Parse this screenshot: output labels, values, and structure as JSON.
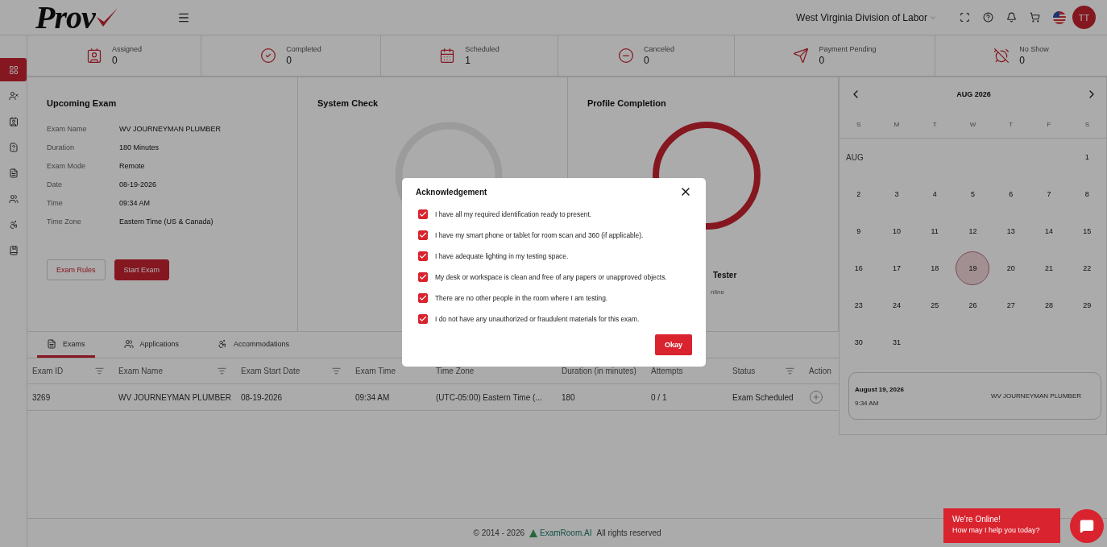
{
  "header": {
    "logo": "Prov",
    "organization": "West Virginia Division of Labor",
    "avatar": "TT"
  },
  "sidebar": {
    "items": [
      {
        "kind": "dashboard",
        "selected": true
      },
      {
        "kind": "user-x",
        "selected": false
      },
      {
        "kind": "badge",
        "selected": false
      },
      {
        "kind": "question",
        "selected": false
      },
      {
        "kind": "document",
        "selected": false
      },
      {
        "kind": "users",
        "selected": false
      },
      {
        "kind": "accessibility",
        "selected": false
      },
      {
        "kind": "book",
        "selected": false
      }
    ]
  },
  "stats": [
    {
      "kind": "assigned",
      "label": "Assigned",
      "value": "0"
    },
    {
      "kind": "completed",
      "label": "Completed",
      "value": "0"
    },
    {
      "kind": "scheduled",
      "label": "Scheduled",
      "value": "1"
    },
    {
      "kind": "canceled",
      "label": "Canceled",
      "value": "0"
    },
    {
      "kind": "payment",
      "label": "Payment Pending",
      "value": "0"
    },
    {
      "kind": "noshow",
      "label": "No Show",
      "value": "0"
    }
  ],
  "upcoming_exam": {
    "title": "Upcoming Exam",
    "fields": [
      {
        "label": "Exam Name",
        "value": "WV JOURNEYMAN PLUMBER"
      },
      {
        "label": "Duration",
        "value": "180 Minutes"
      },
      {
        "label": "Exam Mode",
        "value": "Remote"
      },
      {
        "label": "Date",
        "value": "08-19-2026"
      },
      {
        "label": "Time",
        "value": "09:34 AM"
      },
      {
        "label": "Time Zone",
        "value": "Eastern Time (US & Canada)"
      }
    ],
    "buttons": [
      {
        "label": "Exam Rules",
        "kind": "outline"
      },
      {
        "label": "Start Exam",
        "kind": "primary"
      }
    ]
  },
  "system_check": {
    "title": "System Check"
  },
  "profile_completion": {
    "title": "Profile Completion",
    "name": "Tester",
    "status": "nline"
  },
  "tabs": [
    {
      "kind": "exams",
      "label": "Exams",
      "selected": true
    },
    {
      "kind": "applications",
      "label": "Applications",
      "selected": false
    },
    {
      "kind": "accommodations",
      "label": "Accommodations",
      "selected": false
    }
  ],
  "table": {
    "columns": [
      {
        "label": "Exam ID",
        "filter": true
      },
      {
        "label": "Exam Name",
        "filter": true
      },
      {
        "label": "Exam Start Date",
        "filter": true
      },
      {
        "label": "Exam Time",
        "filter": false
      },
      {
        "label": "Time Zone",
        "filter": false
      },
      {
        "label": "Duration (in minutes)",
        "filter": false
      },
      {
        "label": "Attempts",
        "filter": false
      },
      {
        "label": "Status",
        "filter": true
      },
      {
        "label": "Action",
        "filter": false
      }
    ],
    "rows": [
      {
        "cells": [
          "3269",
          "WV JOURNEYMAN PLUMBER",
          "08-19-2026",
          "09:34 AM",
          "(UTC-05:00) Eastern Time (...",
          "180",
          "0 / 1",
          "Exam Scheduled"
        ]
      }
    ]
  },
  "calendar": {
    "title": "AUG 2026",
    "weekdays": [
      "S",
      "M",
      "T",
      "W",
      "T",
      "F",
      "S"
    ],
    "weeks": [
      [
        {
          "label": "AUG",
          "kind": "month"
        },
        {
          "kind": "blank"
        },
        {
          "kind": "blank"
        },
        {
          "kind": "blank"
        },
        {
          "kind": "blank"
        },
        {
          "kind": "blank"
        },
        {
          "label": "1",
          "kind": "day",
          "selected": false
        }
      ],
      [
        {
          "label": "2",
          "kind": "day",
          "selected": false
        },
        {
          "label": "3",
          "kind": "day",
          "selected": false
        },
        {
          "label": "4",
          "kind": "day",
          "selected": false
        },
        {
          "label": "5",
          "kind": "day",
          "selected": false
        },
        {
          "label": "6",
          "kind": "day",
          "selected": false
        },
        {
          "label": "7",
          "kind": "day",
          "selected": false
        },
        {
          "label": "8",
          "kind": "day",
          "selected": false
        }
      ],
      [
        {
          "label": "9",
          "kind": "day",
          "selected": false
        },
        {
          "label": "10",
          "kind": "day",
          "selected": false
        },
        {
          "label": "11",
          "kind": "day",
          "selected": false
        },
        {
          "label": "12",
          "kind": "day",
          "selected": false
        },
        {
          "label": "13",
          "kind": "day",
          "selected": false
        },
        {
          "label": "14",
          "kind": "day",
          "selected": false
        },
        {
          "label": "15",
          "kind": "day",
          "selected": false
        }
      ],
      [
        {
          "label": "16",
          "kind": "day",
          "selected": false
        },
        {
          "label": "17",
          "kind": "day",
          "selected": false
        },
        {
          "label": "18",
          "kind": "day",
          "selected": false
        },
        {
          "label": "19",
          "kind": "day",
          "selected": true
        },
        {
          "label": "20",
          "kind": "day",
          "selected": false
        },
        {
          "label": "21",
          "kind": "day",
          "selected": false
        },
        {
          "label": "22",
          "kind": "day",
          "selected": false
        }
      ],
      [
        {
          "label": "23",
          "kind": "day",
          "selected": false
        },
        {
          "label": "24",
          "kind": "day",
          "selected": false
        },
        {
          "label": "25",
          "kind": "day",
          "selected": false
        },
        {
          "label": "26",
          "kind": "day",
          "selected": false
        },
        {
          "label": "27",
          "kind": "day",
          "selected": false
        },
        {
          "label": "28",
          "kind": "day",
          "selected": false
        },
        {
          "label": "29",
          "kind": "day",
          "selected": false
        }
      ],
      [
        {
          "label": "30",
          "kind": "day",
          "selected": false
        },
        {
          "label": "31",
          "kind": "day",
          "selected": false
        },
        {
          "kind": "blank"
        },
        {
          "kind": "blank"
        },
        {
          "kind": "blank"
        },
        {
          "kind": "blank"
        },
        {
          "kind": "blank"
        }
      ]
    ],
    "event": {
      "date": "August 19, 2026",
      "time": "9:34 AM",
      "name": "WV JOURNEYMAN PLUMBER"
    }
  },
  "footer": {
    "copyright": "© 2014 - 2026",
    "brand": "ExamRoom.AI",
    "rights": "All rights reserved"
  },
  "modal": {
    "title": "Acknowledgement",
    "items": [
      {
        "text": "I have all my required identification ready to present.",
        "checked": true
      },
      {
        "text": "I have my smart phone or tablet for room scan and 360 (if applicable).",
        "checked": true
      },
      {
        "text": "I have adequate lighting in my testing space.",
        "checked": true
      },
      {
        "text": "My desk or workspace is clean and free of any papers or unapproved objects.",
        "checked": true
      },
      {
        "text": "There are no other people in the room where I am testing.",
        "checked": true
      },
      {
        "text": "I do not have any unauthorized or fraudulent materials for this exam.",
        "checked": true
      }
    ],
    "button": "Okay"
  },
  "chat": {
    "title": "We're Online!",
    "subtitle": "How may I help you today?"
  }
}
